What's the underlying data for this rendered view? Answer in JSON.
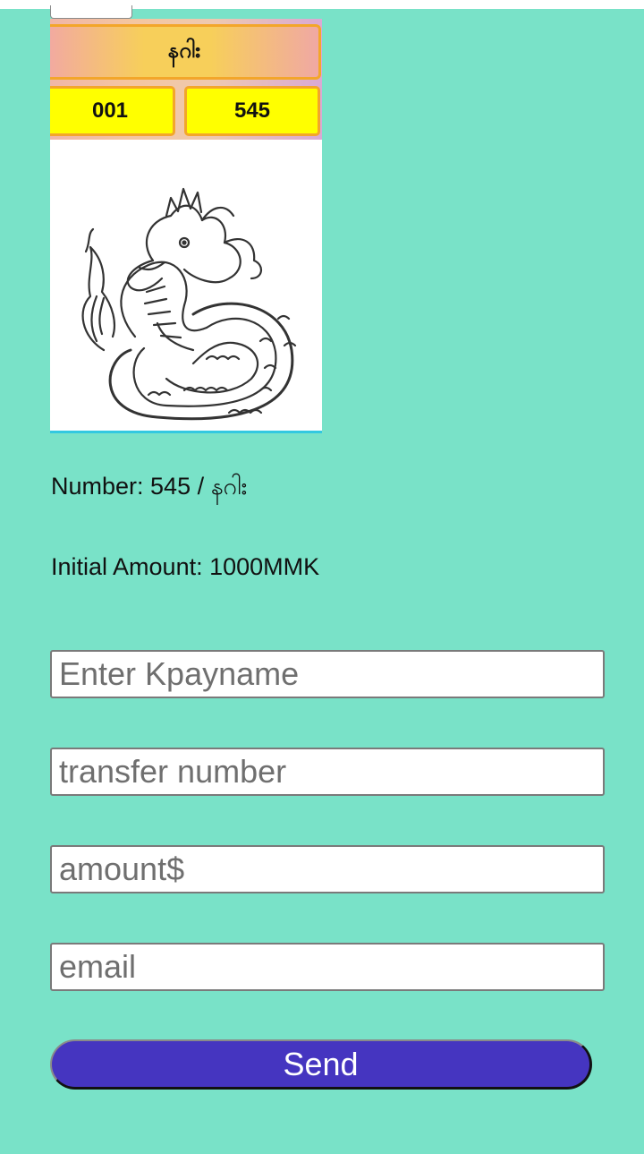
{
  "card": {
    "name": "နဂါး",
    "left_number": "001",
    "right_number": "545",
    "image": "naga-serpent-illustration"
  },
  "info": {
    "number_line": "Number: 545 / နဂါး",
    "amount_line": "Initial Amount: 1000MMK"
  },
  "form": {
    "kpayname_placeholder": "Enter Kpayname",
    "transfer_placeholder": "transfer number",
    "amount_placeholder": "amount$",
    "email_placeholder": "email",
    "send_label": "Send"
  },
  "colors": {
    "background": "#79e2c8",
    "button": "#4535c0",
    "number_box": "#ffff00"
  }
}
